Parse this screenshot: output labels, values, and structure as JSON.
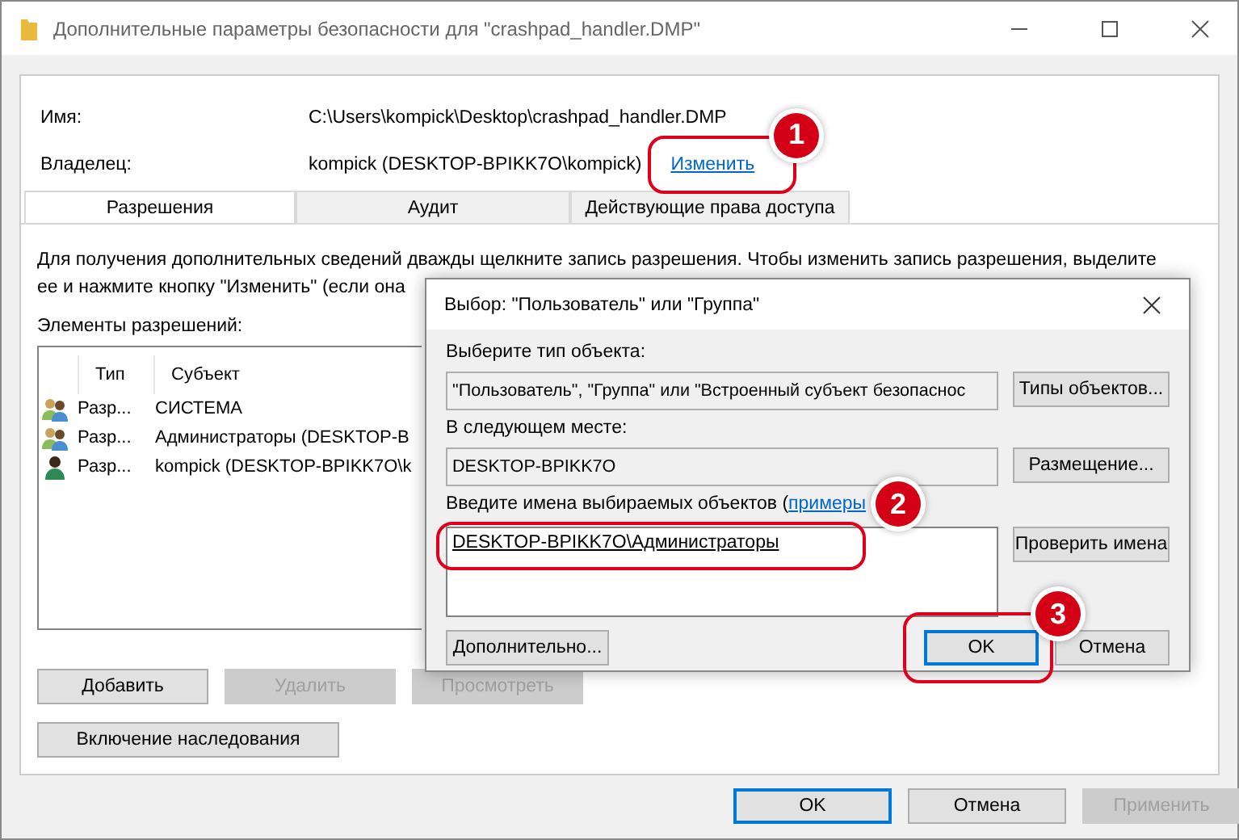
{
  "window": {
    "title": "Дополнительные параметры безопасности  для \"crashpad_handler.DMP\""
  },
  "properties": [
    {
      "label": "Имя:",
      "value": "C:\\Users\\kompick\\Desktop\\crashpad_handler.DMP"
    },
    {
      "label": "Владелец:",
      "value": "kompick (DESKTOP-BPIKK7O\\kompick)",
      "link": "Изменить"
    }
  ],
  "tabs": [
    {
      "label": "Разрешения",
      "selected": true
    },
    {
      "label": "Аудит",
      "selected": false
    },
    {
      "label": "Действующие права доступа",
      "selected": false
    }
  ],
  "description": [
    "Для получения дополнительных сведений дважды щелкните запись разрешения. Чтобы изменить запись разрешения, выделите",
    "ее и нажмите кнопку \"Изменить\" (если она"
  ],
  "list_label": "Элементы разрешений:",
  "table": {
    "columns": [
      "Тип",
      "Субъект"
    ],
    "rows": [
      {
        "kind": "group",
        "type": "Разр...",
        "subject": "СИСТЕМА"
      },
      {
        "kind": "group",
        "type": "Разр...",
        "subject": "Администраторы (DESKTOP-B"
      },
      {
        "kind": "user",
        "type": "Разр...",
        "subject": "kompick (DESKTOP-BPIKK7O\\k"
      }
    ]
  },
  "list_buttons": [
    {
      "label": "Добавить",
      "disabled": false
    },
    {
      "label": "Удалить",
      "disabled": true
    },
    {
      "label": "Просмотреть",
      "disabled": true
    }
  ],
  "inherit_button": "Включение наследования",
  "footer_buttons": [
    {
      "label": "OK",
      "disabled": false,
      "default": true
    },
    {
      "label": "Отмена",
      "disabled": false,
      "default": false
    },
    {
      "label": "Применить",
      "disabled": true,
      "default": false
    }
  ],
  "dialog": {
    "title": "Выбор: \"Пользователь\" или \"Группа\"",
    "object_type": {
      "label": "Выберите тип объекта:",
      "value": "\"Пользователь\", \"Группа\" или \"Встроенный субъект безопаснос",
      "button": "Типы объектов..."
    },
    "location": {
      "label": "В следующем месте:",
      "value": "DESKTOP-BPIKK7O",
      "button": "Размещение..."
    },
    "names": {
      "label": "Введите имена выбираемых объектов (",
      "link": "примеры",
      "value": "DESKTOP-BPIKK7O\\Администраторы",
      "button": "Проверить имена"
    },
    "advanced_button": "Дополнительно...",
    "buttons": [
      {
        "label": "OK",
        "default": true
      },
      {
        "label": "Отмена",
        "default": false
      }
    ]
  },
  "annotations": [
    {
      "number": "1"
    },
    {
      "number": "2"
    },
    {
      "number": "3"
    }
  ]
}
